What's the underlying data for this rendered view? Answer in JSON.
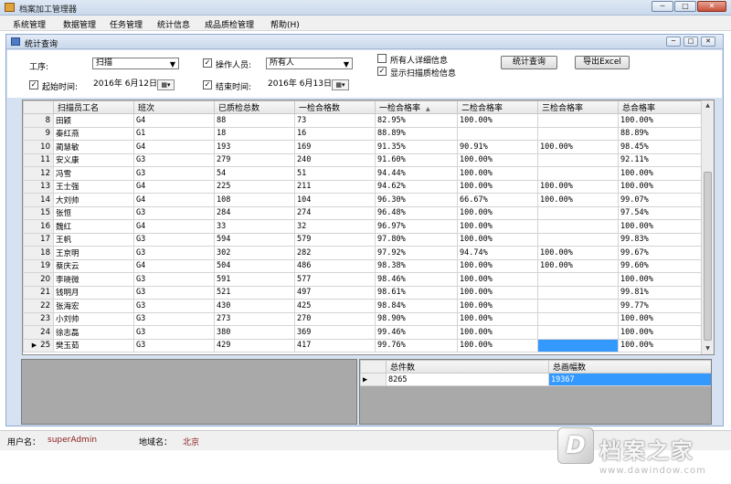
{
  "window": {
    "title": "档案加工管理器",
    "min_glyph": "─",
    "max_glyph": "□",
    "close_glyph": "✕"
  },
  "menu": [
    "系统管理",
    "数据管理",
    "任务管理",
    "统计信息",
    "成品质检管理",
    "帮助(H)"
  ],
  "child": {
    "title": "统计查询",
    "min_glyph": "─",
    "max_glyph": "□",
    "close_glyph": "✕"
  },
  "filters": {
    "process_label": "工序:",
    "process_value": "扫描",
    "operator_checked": true,
    "operator_label": "操作人员:",
    "operator_value": "所有人",
    "all_detail_checked": false,
    "all_detail_label": "所有人详细信息",
    "show_scan_qc_checked": true,
    "show_scan_qc_label": "显示扫描质检信息",
    "stat_button": "统计查询",
    "export_button": "导出Excel",
    "start_checked": true,
    "start_label": "起始时间:",
    "start_date": "2016年 6月12日",
    "end_checked": true,
    "end_label": "结束时间:",
    "end_date": "2016年 6月13日",
    "check_glyph": "✓",
    "combo_arrow": "▼",
    "cal_glyph": "▦▾"
  },
  "grid": {
    "columns": [
      "扫描员工名",
      "班次",
      "已质检总数",
      "一检合格数",
      "一检合格率",
      "二检合格率",
      "三检合格率",
      "总合格率"
    ],
    "sort_glyph": "▲",
    "current_row_glyph": "▶",
    "scroll_up": "▲",
    "scroll_down": "▼",
    "rows": [
      {
        "n": "8",
        "cells": [
          "田颖",
          "G4",
          "88",
          "73",
          "82.95%",
          "100.00%",
          "",
          "100.00%"
        ]
      },
      {
        "n": "9",
        "cells": [
          "秦红燕",
          "G1",
          "18",
          "16",
          "88.89%",
          "",
          "",
          "88.89%"
        ]
      },
      {
        "n": "10",
        "cells": [
          "蔺慧敏",
          "G4",
          "193",
          "169",
          "91.35%",
          "90.91%",
          "100.00%",
          "98.45%"
        ]
      },
      {
        "n": "11",
        "cells": [
          "安义康",
          "G3",
          "279",
          "240",
          "91.60%",
          "100.00%",
          "",
          "92.11%"
        ]
      },
      {
        "n": "12",
        "cells": [
          "冯雪",
          "G3",
          "54",
          "51",
          "94.44%",
          "100.00%",
          "",
          "100.00%"
        ]
      },
      {
        "n": "13",
        "cells": [
          "王士强",
          "G4",
          "225",
          "211",
          "94.62%",
          "100.00%",
          "100.00%",
          "100.00%"
        ]
      },
      {
        "n": "14",
        "cells": [
          "大刘帅",
          "G4",
          "108",
          "104",
          "96.30%",
          "66.67%",
          "100.00%",
          "99.07%"
        ]
      },
      {
        "n": "15",
        "cells": [
          "张恒",
          "G3",
          "284",
          "274",
          "96.48%",
          "100.00%",
          "",
          "97.54%"
        ]
      },
      {
        "n": "16",
        "cells": [
          "魏红",
          "G4",
          "33",
          "32",
          "96.97%",
          "100.00%",
          "",
          "100.00%"
        ]
      },
      {
        "n": "17",
        "cells": [
          "王帆",
          "G3",
          "594",
          "579",
          "97.80%",
          "100.00%",
          "",
          "99.83%"
        ]
      },
      {
        "n": "18",
        "cells": [
          "王京明",
          "G3",
          "302",
          "282",
          "97.92%",
          "94.74%",
          "100.00%",
          "99.67%"
        ]
      },
      {
        "n": "19",
        "cells": [
          "蔡庆云",
          "G4",
          "504",
          "486",
          "98.38%",
          "100.00%",
          "100.00%",
          "99.60%"
        ]
      },
      {
        "n": "20",
        "cells": [
          "李晓微",
          "G3",
          "591",
          "577",
          "98.46%",
          "100.00%",
          "",
          "100.00%"
        ]
      },
      {
        "n": "21",
        "cells": [
          "钱明月",
          "G3",
          "521",
          "497",
          "98.61%",
          "100.00%",
          "",
          "99.81%"
        ]
      },
      {
        "n": "22",
        "cells": [
          "张海宏",
          "G3",
          "430",
          "425",
          "98.84%",
          "100.00%",
          "",
          "99.77%"
        ]
      },
      {
        "n": "23",
        "cells": [
          "小刘帅",
          "G3",
          "273",
          "270",
          "98.90%",
          "100.00%",
          "",
          "100.00%"
        ]
      },
      {
        "n": "24",
        "cells": [
          "徐志磊",
          "G3",
          "380",
          "369",
          "99.46%",
          "100.00%",
          "",
          "100.00%"
        ]
      },
      {
        "n": "25",
        "cells": [
          "樊玉茹",
          "G3",
          "429",
          "417",
          "99.76%",
          "100.00%",
          "",
          "100.00%"
        ]
      }
    ]
  },
  "summary": {
    "columns": [
      "总件数",
      "总画幅数"
    ],
    "row": [
      "8265",
      "19367"
    ]
  },
  "status": {
    "user_label": "用户名：",
    "user_value": "superAdmin",
    "region_label": "地域名：",
    "region_value": "北京"
  },
  "watermark": {
    "logo": "D",
    "cn": "档案之家",
    "url": "www.dawindow.com"
  }
}
